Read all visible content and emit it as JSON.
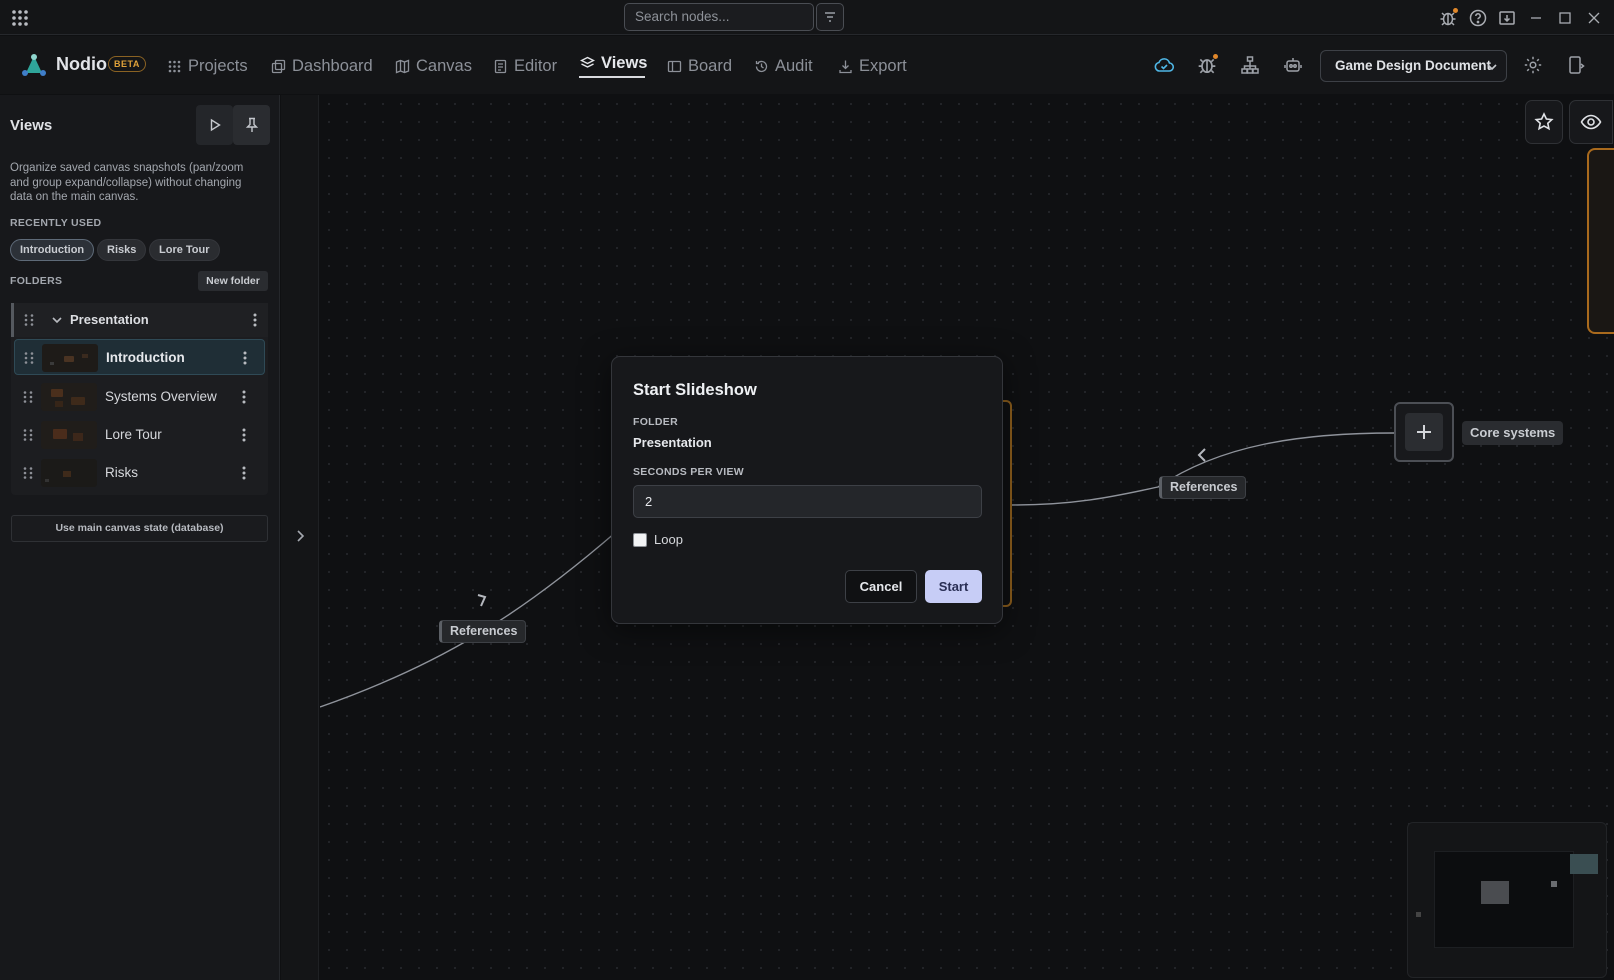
{
  "titlebar": {
    "search_placeholder": "Search nodes..."
  },
  "nav": {
    "brand": "Nodio",
    "badge": "BETA",
    "items": [
      {
        "label": "Projects",
        "icon": "grid-icon"
      },
      {
        "label": "Dashboard",
        "icon": "copy-icon"
      },
      {
        "label": "Canvas",
        "icon": "map-icon"
      },
      {
        "label": "Editor",
        "icon": "document-icon"
      },
      {
        "label": "Views",
        "icon": "layers-icon",
        "active": true
      },
      {
        "label": "Board",
        "icon": "board-icon"
      },
      {
        "label": "Audit",
        "icon": "history-icon"
      },
      {
        "label": "Export",
        "icon": "download-icon"
      }
    ],
    "document_select": "Game Design Document"
  },
  "sidebar": {
    "title": "Views",
    "description": "Organize saved canvas snapshots (pan/zoom and group expand/collapse) without changing data on the main canvas.",
    "recently_used_heading": "RECENTLY USED",
    "recent": [
      "Introduction",
      "Risks",
      "Lore Tour"
    ],
    "folders_heading": "FOLDERS",
    "new_folder": "New folder",
    "folder": {
      "name": "Presentation",
      "views": [
        {
          "name": "Introduction",
          "active": true
        },
        {
          "name": "Systems Overview"
        },
        {
          "name": "Lore Tour"
        },
        {
          "name": "Risks"
        }
      ]
    },
    "use_main": "Use main canvas state (database)"
  },
  "canvas": {
    "edge_label_left": "References",
    "edge_label_right": "References",
    "core_label": "Core systems"
  },
  "modal": {
    "title": "Start Slideshow",
    "folder_label": "FOLDER",
    "folder_value": "Presentation",
    "seconds_label": "SECONDS PER VIEW",
    "seconds_value": "2",
    "loop_label": "Loop",
    "loop_checked": false,
    "cancel": "Cancel",
    "start": "Start"
  },
  "colors": {
    "accent_start": "#c7cdf6",
    "node_orange": "#a96a1d",
    "beta_badge": "#e0a23a",
    "notification_dot": "#e0872a"
  }
}
